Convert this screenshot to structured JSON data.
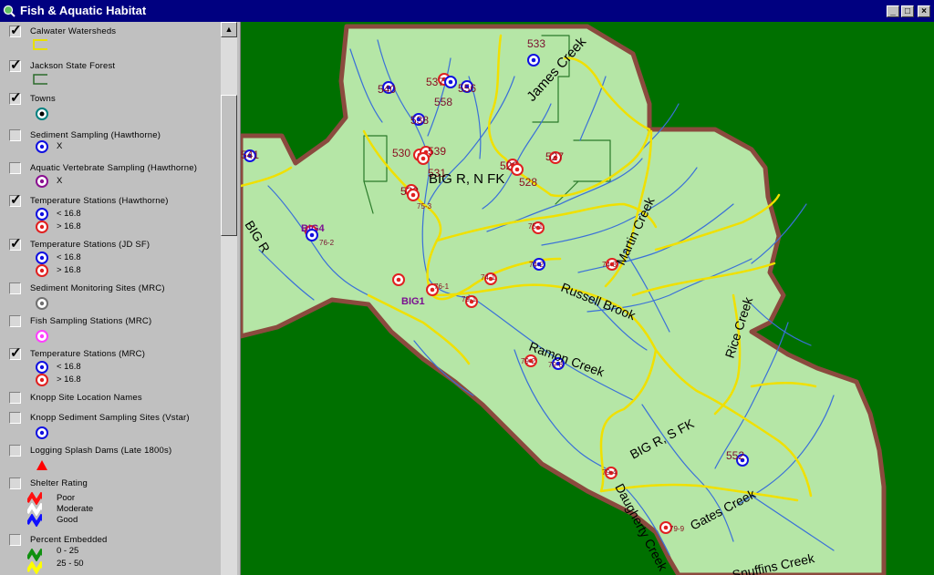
{
  "window": {
    "title": "Fish & Aquatic Habitat",
    "min_label": "_",
    "max_label": "□",
    "close_label": "×"
  },
  "legend": {
    "layers": [
      {
        "name": "Calwater Watersheds",
        "checked": true
      },
      {
        "name": "Jackson State Forest",
        "checked": true
      },
      {
        "name": "Towns",
        "checked": true
      },
      {
        "name": "Sediment Sampling (Hawthorne)",
        "checked": false,
        "sub": [
          "X"
        ]
      },
      {
        "name": "Aquatic Vertebrate Sampling (Hawthorne)",
        "checked": false,
        "sub": [
          "X"
        ]
      },
      {
        "name": "Temperature Stations (Hawthorne)",
        "checked": true,
        "sub": [
          "< 16.8",
          "> 16.8"
        ]
      },
      {
        "name": "Temperature Stations (JD SF)",
        "checked": true,
        "sub": [
          "< 16.8",
          "> 16.8"
        ]
      },
      {
        "name": "Sediment Monitoring Sites (MRC)",
        "checked": false
      },
      {
        "name": "Fish Sampling Stations (MRC)",
        "checked": false
      },
      {
        "name": "Temperature Stations (MRC)",
        "checked": true,
        "sub": [
          "< 16.8",
          "> 16.8"
        ]
      },
      {
        "name": "Knopp Site Location Names",
        "checked": false
      },
      {
        "name": "Knopp Sediment Sampling Sites (Vstar)",
        "checked": false
      },
      {
        "name": "Logging Splash Dams (Late 1800s)",
        "checked": false
      },
      {
        "name": "Shelter Rating",
        "checked": false,
        "sub": [
          "Poor",
          "Moderate",
          "Good"
        ]
      },
      {
        "name": "Percent Embedded",
        "checked": false,
        "sub": [
          "0 - 25",
          "25 - 50"
        ]
      }
    ]
  },
  "colors": {
    "map_bg": "#007000",
    "watershed_fill": "#b5e6a6",
    "watershed_border": "#8b4a3e",
    "boundary": "#f0e000",
    "stream": "#3a70d8",
    "below_icon": "#1010e0",
    "above_icon": "#e02020",
    "forest_line": "#2a7a2a"
  },
  "map": {
    "stream_names": [
      "James Creek",
      "BIG R, N FK",
      "BIG R",
      "Martin Creek",
      "Russell Brook",
      "Rice Creek",
      "Ramon Creek",
      "BIG R, S FK",
      "Gates Creek",
      "Daugherty Creek",
      "Snuffins Creek"
    ],
    "site_codes": [
      "533",
      "540",
      "537",
      "556",
      "558",
      "538",
      "541",
      "530",
      "539",
      "531",
      "529",
      "527",
      "528",
      "532",
      "75-3",
      "BIG4",
      "76-2",
      "75-1",
      "74-2",
      "74-3",
      "76-1",
      "74-1",
      "BIG1",
      "79-1",
      "79-2",
      "79-8",
      "552",
      "79-4",
      "79-9"
    ]
  }
}
